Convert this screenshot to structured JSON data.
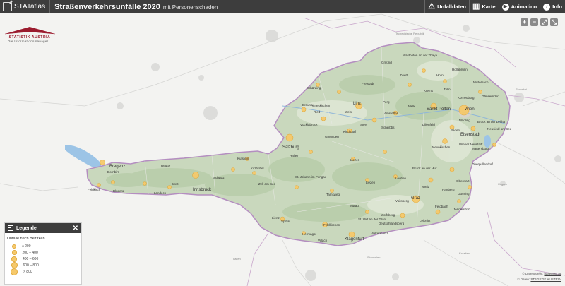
{
  "header": {
    "app_name": "STATatlas",
    "title": "Straßenverkehrsunfälle 2020",
    "subtitle": "mit Personenschaden",
    "tools": [
      {
        "label": "Unfalldaten",
        "icon": "warning-icon"
      },
      {
        "label": "Karte",
        "icon": "book-icon"
      },
      {
        "label": "Animation",
        "icon": "play-icon"
      },
      {
        "label": "Info",
        "icon": "info-icon"
      }
    ]
  },
  "logo": {
    "name": "STATISTIK AUSTRIA",
    "tagline": "Die Informationsmanager"
  },
  "map_controls": [
    "+",
    "−",
    "⤢",
    "⤡"
  ],
  "countries": [
    "Tschechische Republik",
    "Slowakei",
    "Ungarn",
    "Slowenien",
    "Kroatien",
    "Italien"
  ],
  "cities": [
    "Braunau",
    "Ried",
    "Schärding",
    "Grieskirchen",
    "Wels",
    "Linz",
    "Freistadt",
    "Perg",
    "Steyr",
    "Kirchdorf",
    "Gmunden",
    "Vöcklabruck",
    "Salzburg",
    "Hallein",
    "Zell am See",
    "St. Johann im Pongau",
    "Tamsweg",
    "Liezen",
    "Leoben",
    "Bruck an der Mur",
    "Graz",
    "Weiz",
    "Hartberg",
    "Feldbach",
    "Leibnitz",
    "Deutschlandsberg",
    "Voitsberg",
    "Murau",
    "Wolfsberg",
    "St. Veit an der Glan",
    "Feldkirchen",
    "Klagenfurt",
    "Völkermarkt",
    "Villach",
    "Hermagor",
    "Spittal",
    "Lienz",
    "Kufstein",
    "Kitzbühel",
    "Schwaz",
    "Innsbruck",
    "Imst",
    "Landeck",
    "Reutte",
    "Bludenz",
    "Feldkirch",
    "Bregenz",
    "Dornbirn",
    "Zwettl",
    "Krems",
    "Melk",
    "Amstetten",
    "Scheibbs",
    "Lilienfeld",
    "Sankt Pölten",
    "Tulln",
    "Korneuburg",
    "Mistelbach",
    "Hollabrunn",
    "Horn",
    "Gmünd",
    "Waidhofen an der Thaya",
    "Wien",
    "Mödling",
    "Baden",
    "Wiener Neustadt",
    "Neunkirchen",
    "Eisenstadt",
    "Mattersburg",
    "Oberpullendorf",
    "Oberwart",
    "Güssing",
    "Jennersdorf",
    "Bruck an der Leitha",
    "Neusiedl am See",
    "Gänserndorf"
  ],
  "legend": {
    "title": "Legende",
    "subtitle": "Unfälle nach Bezirken",
    "classes": [
      "≤ 200",
      "200 – 400",
      "400 – 600",
      "600 – 800",
      "> 800"
    ]
  },
  "credits": {
    "line1_prefix": "© Datenquelle:",
    "line1_link": "basemap.at",
    "line2_prefix": "© Daten:",
    "line2_link": "STATISTIK AUSTRIA"
  }
}
